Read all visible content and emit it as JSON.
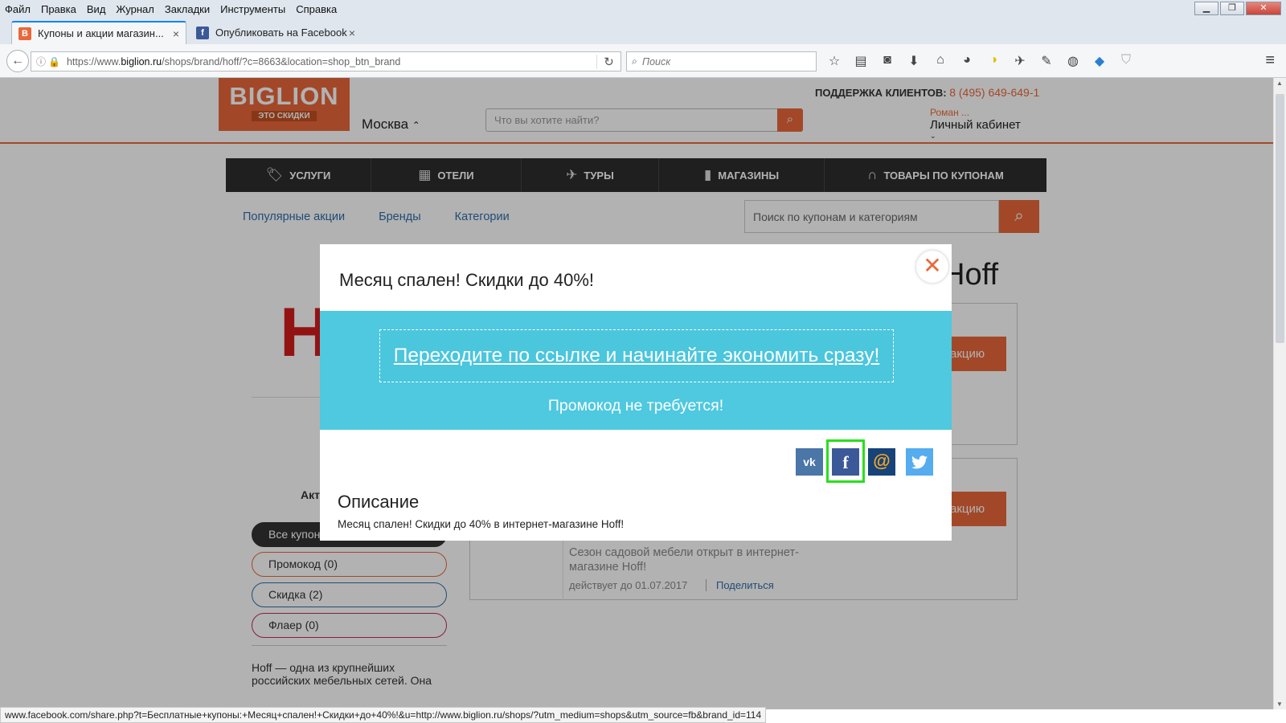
{
  "browser": {
    "menu": [
      "Файл",
      "Правка",
      "Вид",
      "Журнал",
      "Закладки",
      "Инструменты",
      "Справка"
    ],
    "tabs": [
      {
        "title": "Купоны и акции магазин...",
        "favicon": "В",
        "active": true
      },
      {
        "title": "Опубликовать на Facebook",
        "favicon": "f",
        "active": false
      }
    ],
    "new_tab": "+",
    "url_prefix": "https://www.",
    "url_domain": "biglion.ru",
    "url_path": "/shops/brand/hoff/?c=8663&location=shop_btn_brand",
    "search_placeholder": "Поиск",
    "status_url": "www.facebook.com/share.php?t=Бесплатные+купоны:+Месяц+спален!+Скидки+до+40%!&u=http://www.biglion.ru/shops/?utm_medium=shops&utm_source=fb&brand_id=114"
  },
  "site": {
    "logo_big": "BIGLION",
    "logo_small": "ЭТО СКИДКИ",
    "city": "Москва",
    "top_search_placeholder": "Что вы хотите найти?",
    "support_label": "ПОДДЕРЖКА КЛИЕНТОВ:",
    "support_phone": "8 (495) 649-649-1",
    "user_name": "Роман ...",
    "cabinet": "Личный кабинет",
    "categories": [
      {
        "label": "УСЛУГИ",
        "icon": "tag-icon"
      },
      {
        "label": "ОТЕЛИ",
        "icon": "hotel-icon"
      },
      {
        "label": "ТУРЫ",
        "icon": "plane-icon"
      },
      {
        "label": "МАГАЗИНЫ",
        "icon": "bag-icon"
      },
      {
        "label": "ТОВАРЫ ПО КУПОНАМ",
        "icon": "headphones-icon"
      }
    ],
    "subnav": [
      "Популярные акции",
      "Бренды",
      "Категории"
    ],
    "coupon_search_placeholder": "Поиск по купонам и категориям"
  },
  "page": {
    "brand_logo": "H",
    "brand_title": "Hoff",
    "filter_heading": "Акт",
    "filters": [
      "Все купон",
      "Промокод (0)",
      "Скидка (2)",
      "Флаер (0)"
    ],
    "brand_description": "Hoff — одна из крупнейших российских мебельных сетей. Она",
    "cta": "акцию",
    "card2_text": "Сезон садовой мебели открыт в интернет-магазине Hoff!",
    "card2_until": "действует до 01.07.2017",
    "card2_share": "Поделиться"
  },
  "modal": {
    "title": "Месяц спален! Скидки до 40%!",
    "link_text": "Переходите по ссылке и начинайте экономить сразу!",
    "no_promo": "Промокод не требуется!",
    "desc_heading": "Описание",
    "desc_text": "Месяц спален! Скидки до 40% в интернет-магазине Hoff!",
    "close_glyph": "✕",
    "share": {
      "vk": "vk",
      "fb": "f",
      "mail": "@"
    }
  },
  "colors": {
    "accent": "#e8683a",
    "band": "#4ec9df",
    "highlight": "#27e01d",
    "link": "#2f6da8"
  }
}
